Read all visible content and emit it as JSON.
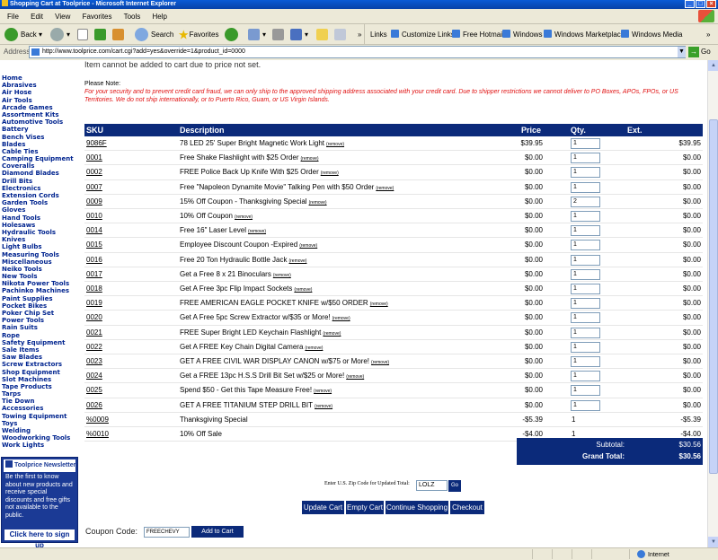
{
  "window": {
    "title": "Shopping Cart at Toolprice - Microsoft Internet Explorer"
  },
  "menu": [
    "File",
    "Edit",
    "View",
    "Favorites",
    "Tools",
    "Help"
  ],
  "toolbar": {
    "back": "Back",
    "search": "Search",
    "favorites": "Favorites",
    "links_label": "Links"
  },
  "links": [
    "Customize Links",
    "Free Hotmail",
    "Windows",
    "Windows Marketplace",
    "Windows Media"
  ],
  "address": {
    "label": "Address",
    "url": "http://www.toolprice.com/cart.cgi?add=yes&override=1&product_id=0000",
    "go": "Go"
  },
  "sidebar": {
    "categories": [
      "Home",
      "Abrasives",
      "Air Hose",
      "Air Tools",
      "Arcade Games",
      "Assortment Kits",
      "Automotive Tools",
      "Battery",
      "Bench Vises",
      "Blades",
      "Cable Ties",
      "Camping Equipment",
      "Coveralls",
      "Diamond Blades",
      "Drill Bits",
      "Electronics",
      "Extension Cords",
      "Garden Tools",
      "Gloves",
      "Hand Tools",
      "Holesaws",
      "Hydraulic Tools",
      "Knives",
      "Light Bulbs",
      "Measuring Tools",
      "Miscellaneous",
      "Neiko Tools",
      "New Tools",
      "Nikota Power Tools",
      "Pachinko Machines",
      "Paint Supplies",
      "Pocket Bikes",
      "Poker Chip Set",
      "Power Tools",
      "Rain Suits",
      "Rope",
      "Safety Equipment",
      "Sale Items",
      "Saw Blades",
      "Screw Extractors",
      "Shop Equipment",
      "Slot Machines",
      "Tape Products",
      "Tarps",
      "Tie Down",
      "Accessories",
      "Towing Equipment",
      "Toys",
      "Welding",
      "Woodworking Tools",
      "Work Lights"
    ],
    "newsletter": {
      "title": "Toolprice Newsletter",
      "text": "Be the first to know about new products and receive special discounts and free gifts not available to the public.",
      "button": "Click here to sign up"
    }
  },
  "notice": {
    "error": "Item cannot be added to cart due to price not set.",
    "please_note": "Please Note:",
    "warning": "For your security and to prevent credit card fraud, we can only ship to the approved shipping address associated with your credit card. Due to shipper restrictions we cannot deliver to PO Boxes, APOs, FPOs, or US Territories. We do not ship internationally, or to Puerto Rico, Guam, or US Virgin Islands."
  },
  "cart": {
    "headers": {
      "sku": "SKU",
      "description": "Description",
      "price": "Price",
      "qty": "Qty.",
      "ext": "Ext."
    },
    "remove_label": "(remove)",
    "items": [
      {
        "sku": "9086F",
        "desc": "78 LED 25' Super Bright Magnetic Work Light",
        "price": "$39.95",
        "qty": "1",
        "ext": "$39.95",
        "editable": true
      },
      {
        "sku": "0001",
        "desc": "Free Shake Flashlight with $25 Order",
        "price": "$0.00",
        "qty": "1",
        "ext": "$0.00",
        "editable": true
      },
      {
        "sku": "0002",
        "desc": "FREE Police Back Up Knife With $25 Order",
        "price": "$0.00",
        "qty": "1",
        "ext": "$0.00",
        "editable": true
      },
      {
        "sku": "0007",
        "desc": "Free \"Napoleon Dynamite Movie\" Talking Pen with $50 Order",
        "price": "$0.00",
        "qty": "1",
        "ext": "$0.00",
        "editable": true
      },
      {
        "sku": "0009",
        "desc": "15% Off Coupon - Thanksgiving Special",
        "price": "$0.00",
        "qty": "2",
        "ext": "$0.00",
        "editable": true
      },
      {
        "sku": "0010",
        "desc": "10% Off Coupon",
        "price": "$0.00",
        "qty": "1",
        "ext": "$0.00",
        "editable": true
      },
      {
        "sku": "0014",
        "desc": "Free 16\" Laser Level",
        "price": "$0.00",
        "qty": "1",
        "ext": "$0.00",
        "editable": true
      },
      {
        "sku": "0015",
        "desc": "Employee Discount Coupon -Expired",
        "price": "$0.00",
        "qty": "1",
        "ext": "$0.00",
        "editable": true
      },
      {
        "sku": "0016",
        "desc": "Free 20 Ton Hydraulic Bottle Jack",
        "price": "$0.00",
        "qty": "1",
        "ext": "$0.00",
        "editable": true
      },
      {
        "sku": "0017",
        "desc": "Get a Free 8 x 21 Binoculars",
        "price": "$0.00",
        "qty": "1",
        "ext": "$0.00",
        "editable": true
      },
      {
        "sku": "0018",
        "desc": "Get A Free 3pc Flip Impact Sockets",
        "price": "$0.00",
        "qty": "1",
        "ext": "$0.00",
        "editable": true
      },
      {
        "sku": "0019",
        "desc": "FREE AMERICAN EAGLE POCKET KNIFE w/$50 ORDER",
        "price": "$0.00",
        "qty": "1",
        "ext": "$0.00",
        "editable": true
      },
      {
        "sku": "0020",
        "desc": "Get A Free 5pc Screw Extractor w/$35 or More!",
        "price": "$0.00",
        "qty": "1",
        "ext": "$0.00",
        "editable": true
      },
      {
        "sku": "0021",
        "desc": "FREE Super Bright LED Keychain Flashlight",
        "price": "$0.00",
        "qty": "1",
        "ext": "$0.00",
        "editable": true
      },
      {
        "sku": "0022",
        "desc": "Get A FREE Key Chain Digital Camera",
        "price": "$0.00",
        "qty": "1",
        "ext": "$0.00",
        "editable": true
      },
      {
        "sku": "0023",
        "desc": "GET A FREE CIVIL WAR DISPLAY CANON w/$75 or More!",
        "price": "$0.00",
        "qty": "1",
        "ext": "$0.00",
        "editable": true
      },
      {
        "sku": "0024",
        "desc": "Get a FREE 13pc H.S.S Drill Bit Set w/$25 or More!",
        "price": "$0.00",
        "qty": "1",
        "ext": "$0.00",
        "editable": true
      },
      {
        "sku": "0025",
        "desc": "Spend $50 - Get this Tape Measure Free!",
        "price": "$0.00",
        "qty": "1",
        "ext": "$0.00",
        "editable": true
      },
      {
        "sku": "0026",
        "desc": "GET A FREE TITANIUM STEP DRILL BIT",
        "price": "$0.00",
        "qty": "1",
        "ext": "$0.00",
        "editable": true
      },
      {
        "sku": "%0009",
        "desc": "Thanksgiving Special",
        "price": "-$5.39",
        "qty": "1",
        "ext": "-$5.39",
        "editable": false
      },
      {
        "sku": "%0010",
        "desc": "10% Off Sale",
        "price": "-$4.00",
        "qty": "1",
        "ext": "-$4.00",
        "editable": false
      }
    ],
    "subtotal_label": "Subtotal:",
    "subtotal": "$30.56",
    "grand_total_label": "Grand Total:",
    "grand_total": "$30.56"
  },
  "zip": {
    "label": "Enter U.S. Zip Code for Updated Total:",
    "value": "LOLZ",
    "go": "Go"
  },
  "actions": {
    "update": "Update Cart",
    "empty": "Empty Cart",
    "continue": "Continue Shopping",
    "checkout": "Checkout"
  },
  "coupon": {
    "label": "Coupon Code:",
    "value": "FREECHEVY",
    "add": "Add to Cart"
  },
  "status": {
    "zone": "Internet"
  },
  "colors": {
    "brand_navy": "#0b2a7a",
    "warning_red": "#e01010",
    "sidebar_link": "#00248f"
  }
}
